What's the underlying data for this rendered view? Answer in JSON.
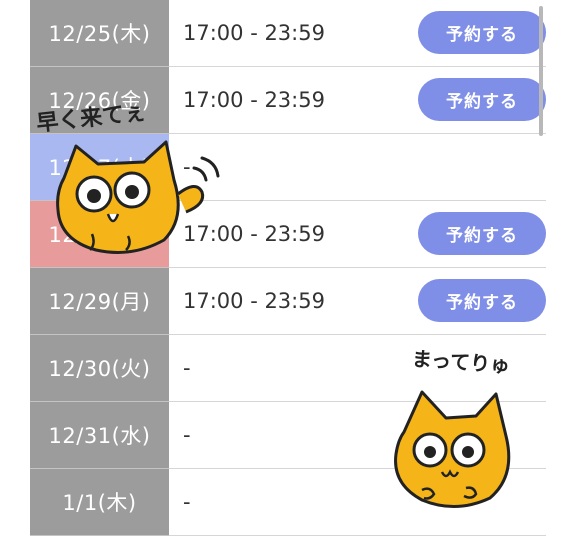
{
  "slots": [
    {
      "date": "12/25(木)",
      "time": "17:00 - 23:59",
      "button": "予約する"
    },
    {
      "date": "12/26(金)",
      "time": "17:00 - 23:59",
      "button": "予約する"
    },
    {
      "date": "12/27(土)",
      "time": "-",
      "button": ""
    },
    {
      "date": "12/28(日)",
      "time": "17:00 - 23:59",
      "button": "予約する"
    },
    {
      "date": "12/29(月)",
      "time": "17:00 - 23:59",
      "button": "予約する"
    },
    {
      "date": "12/30(火)",
      "time": "-",
      "button": ""
    },
    {
      "date": "12/31(水)",
      "time": "-",
      "button": ""
    },
    {
      "date": "1/1(木)",
      "time": "-",
      "button": ""
    }
  ],
  "stickers": {
    "top_caption": "早く来てぇ",
    "bottom_caption": "まってりゅ"
  },
  "colors": {
    "date_cell": "#9c9c9c",
    "saturday_cell": "#a9b8f0",
    "sunday_cell": "#e79b9b",
    "reserve_button": "#7f8ee6",
    "cat": "#f5b418"
  }
}
